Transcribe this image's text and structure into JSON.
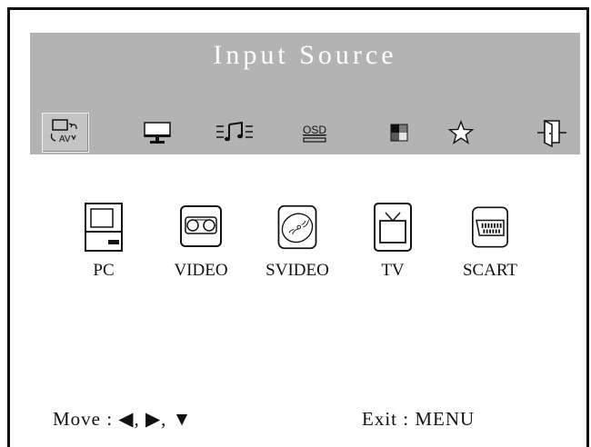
{
  "menu": {
    "title": "Input Source",
    "icons": [
      {
        "name": "input-source-icon",
        "selected": true
      },
      {
        "name": "picture-icon",
        "selected": false
      },
      {
        "name": "audio-icon",
        "selected": false
      },
      {
        "name": "osd-icon",
        "selected": false,
        "label": "OSD"
      },
      {
        "name": "color-icon",
        "selected": false
      },
      {
        "name": "favorite-icon",
        "selected": false
      },
      {
        "name": "exit-door-icon",
        "selected": false
      }
    ]
  },
  "sources": [
    {
      "label": "PC",
      "icon": "pc-icon"
    },
    {
      "label": "VIDEO",
      "icon": "video-icon"
    },
    {
      "label": "SVIDEO",
      "icon": "svideo-icon"
    },
    {
      "label": "TV",
      "icon": "tv-icon"
    },
    {
      "label": "SCART",
      "icon": "scart-icon"
    }
  ],
  "footer": {
    "move_label": "Move : ◀, ▶, ▼",
    "exit_label": "Exit : MENU"
  },
  "colors": {
    "menu_bar": "#b3b3b3",
    "title_text": "#ffffff",
    "text": "#111111"
  }
}
